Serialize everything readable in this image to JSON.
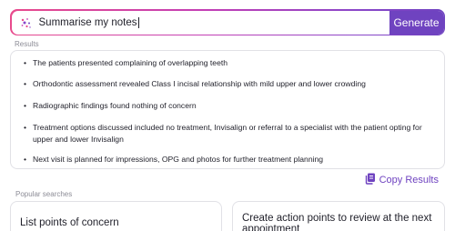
{
  "search": {
    "value": "Summarise my notes",
    "generate_label": "Generate"
  },
  "results": {
    "label": "Results",
    "items": [
      "The patients presented complaining of overlapping teeth",
      "Orthodontic assessment revealed Class I incisal relationship with mild upper and lower crowding",
      "Radiographic findings found nothing of concern",
      "Treatment options discussed included no treatment, Invisalign or referral to a specialist with the patient opting for upper and lower Invisalign",
      "Next visit is planned for impressions, OPG and photos for further treatment planning"
    ],
    "copy_label": "Copy Results"
  },
  "popular": {
    "label": "Popular searches",
    "items": [
      "List points of concern",
      "Create action points to review at the next appointment"
    ]
  },
  "colors": {
    "accent": "#6f43c0",
    "gradient_start": "#e84a8c"
  },
  "icons": {
    "search": "sparkle-icon",
    "copy": "copy-icon"
  }
}
